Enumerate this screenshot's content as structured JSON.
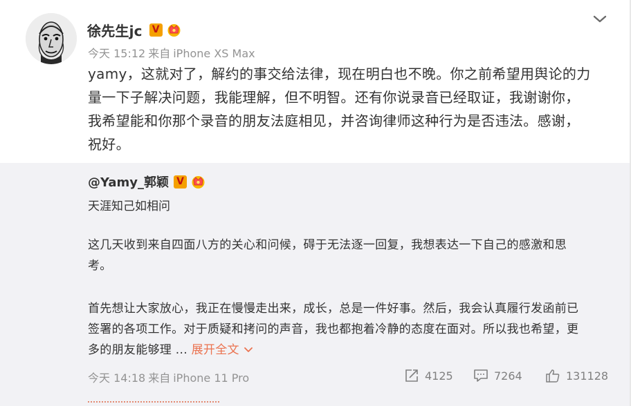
{
  "post": {
    "author_name": "徐先生jc",
    "verified_mark": "V",
    "time": "今天 15:12",
    "source_prefix": "来自",
    "source_device": "iPhone XS Max",
    "text_lines": [
      "yamy，这就对了，解约的事交给法律，现在明白也不晚。你之前希望用舆论的力",
      "量一下子解决问题，我能理解，但不明智。还有你说录音已经取证，我谢谢你，",
      "我希望能和你那个录音的朋友法庭相见，并咨询律师这种行为是否违法。感谢，",
      "祝好。"
    ]
  },
  "retweet": {
    "author_name": "@Yamy_郭颖",
    "verified_mark": "V",
    "line1": "天涯知己如相问",
    "para1": [
      "这几天收到来自四面八方的关心和问候，碍于无法逐一回复，我想表达一下自己的感激和思",
      "考。"
    ],
    "para2": [
      "首先想让大家放心，我正在慢慢走出来，成长，总是一件好事。然后，我会认真履行发函前已",
      "签署的各项工作。对于质疑和拷问的声音，我也都抱着冷静的态度在面对。所以我也希望，更"
    ],
    "para2_last": "多的朋友能够理 ... ",
    "expand_label": "展开全文",
    "time": "今天 14:18",
    "source_prefix": "来自",
    "source_device": "iPhone 11 Pro",
    "repost_count": "4125",
    "comment_count": "7264",
    "like_count": "131128"
  },
  "colors": {
    "accent_link": "#eb7350",
    "verified_badge": "#f5a000",
    "retweet_bg": "#f2f2f5",
    "meta_gray": "#939393"
  },
  "icons": {
    "caret": "chevron-down-icon",
    "repost": "repost-icon",
    "comment": "comment-icon",
    "like": "thumbs-up-icon"
  }
}
